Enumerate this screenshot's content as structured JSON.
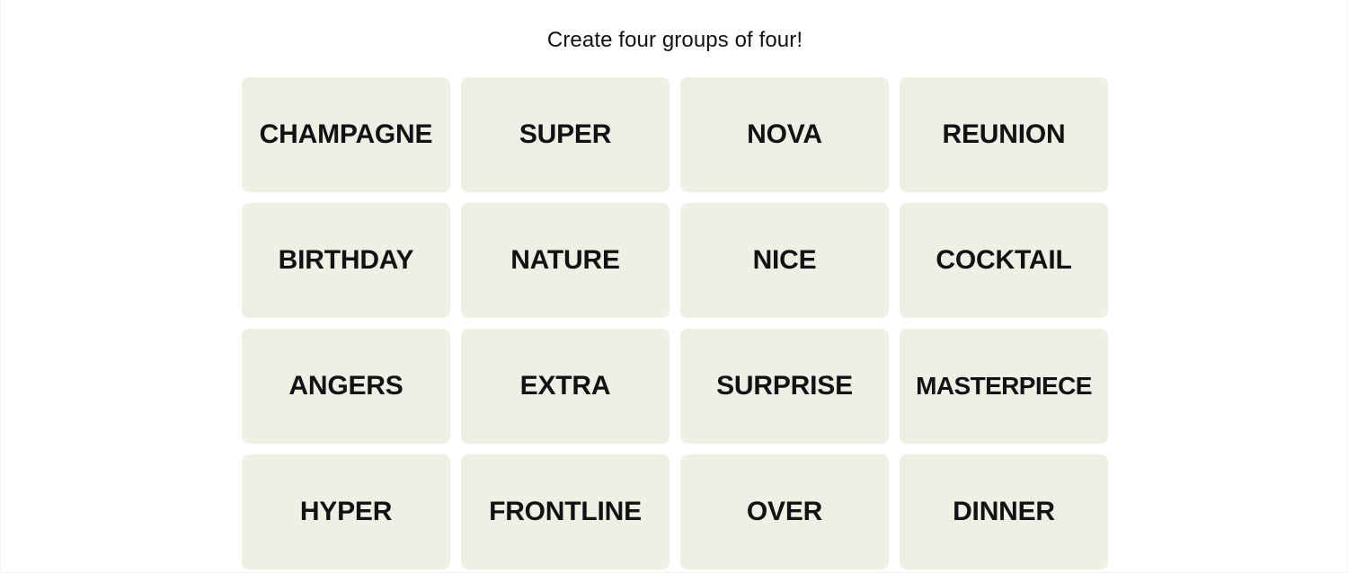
{
  "colors": {
    "page_background": "#ffffff",
    "tile_background": "#efefe6",
    "text": "#121212",
    "frame_border": "#f4f4f4"
  },
  "header": {
    "instruction": "Create four groups of four!"
  },
  "board": {
    "columns": 4,
    "rows": 4,
    "tiles": [
      {
        "label": "CHAMPAGNE",
        "row": 1,
        "col": 1,
        "selected": false
      },
      {
        "label": "SUPER",
        "row": 1,
        "col": 2,
        "selected": false
      },
      {
        "label": "NOVA",
        "row": 1,
        "col": 3,
        "selected": false
      },
      {
        "label": "REUNION",
        "row": 1,
        "col": 4,
        "selected": false
      },
      {
        "label": "BIRTHDAY",
        "row": 2,
        "col": 1,
        "selected": false
      },
      {
        "label": "NATURE",
        "row": 2,
        "col": 2,
        "selected": false
      },
      {
        "label": "NICE",
        "row": 2,
        "col": 3,
        "selected": false
      },
      {
        "label": "COCKTAIL",
        "row": 2,
        "col": 4,
        "selected": false
      },
      {
        "label": "ANGERS",
        "row": 3,
        "col": 1,
        "selected": false
      },
      {
        "label": "EXTRA",
        "row": 3,
        "col": 2,
        "selected": false
      },
      {
        "label": "SURPRISE",
        "row": 3,
        "col": 3,
        "selected": false
      },
      {
        "label": "MASTERPIECE",
        "row": 3,
        "col": 4,
        "selected": false
      },
      {
        "label": "HYPER",
        "row": 4,
        "col": 1,
        "selected": false
      },
      {
        "label": "FRONTLINE",
        "row": 4,
        "col": 2,
        "selected": false
      },
      {
        "label": "OVER",
        "row": 4,
        "col": 3,
        "selected": false
      },
      {
        "label": "DINNER",
        "row": 4,
        "col": 4,
        "selected": false
      }
    ]
  }
}
